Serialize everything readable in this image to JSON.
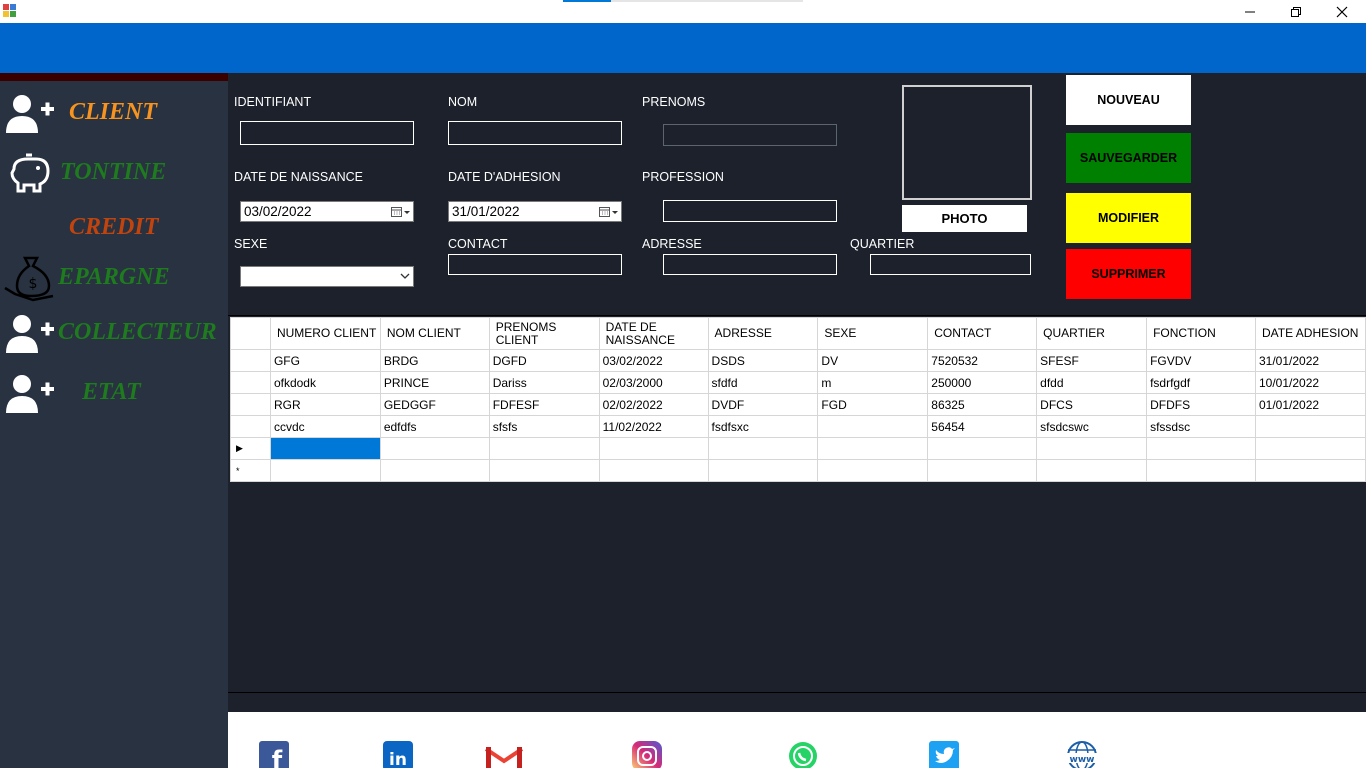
{
  "window": {
    "controls": [
      "minimize",
      "restore",
      "close"
    ]
  },
  "sidebar": {
    "items": [
      {
        "label": "CLIENT",
        "color": "#f7931e"
      },
      {
        "label": "TONTINE",
        "color": "#1e7b1e"
      },
      {
        "label": "CREDIT",
        "color": "#c1440e"
      },
      {
        "label": "EPARGNE",
        "color": "#1e7b1e"
      },
      {
        "label": "COLLECTEUR",
        "color": "#1e7b1e"
      },
      {
        "label": "ETAT",
        "color": "#1e7b1e"
      }
    ]
  },
  "form": {
    "labels": {
      "identifiant": "IDENTIFIANT",
      "nom": "NOM",
      "prenoms": "PRENOMS",
      "date_naissance": "DATE DE NAISSANCE",
      "date_adhesion": "DATE D'ADHESION",
      "profession": "PROFESSION",
      "sexe": "SEXE",
      "contact": "CONTACT",
      "adresse": "ADRESSE",
      "quartier": "QUARTIER"
    },
    "values": {
      "identifiant": "",
      "nom": "",
      "prenoms": "",
      "date_naissance": "03/02/2022",
      "date_adhesion": "31/01/2022",
      "profession": "",
      "sexe": "",
      "contact": "",
      "adresse": "",
      "quartier": ""
    },
    "photo_label": "PHOTO"
  },
  "actions": {
    "nouveau": {
      "label": "NOUVEAU",
      "color": "#ffffff"
    },
    "sauvegarder": {
      "label": "SAUVEGARDER",
      "color": "#008000"
    },
    "modifier": {
      "label": "MODIFIER",
      "color": "#ffff00"
    },
    "supprimer": {
      "label": "SUPPRIMER",
      "color": "#ff0000"
    }
  },
  "grid": {
    "columns": [
      "NUMERO CLIENT",
      "NOM CLIENT",
      "PRENOMS CLIENT",
      "DATE DE NAISSANCE",
      "ADRESSE",
      "SEXE",
      "CONTACT",
      "QUARTIER",
      "FONCTION",
      "DATE ADHESION"
    ],
    "rows": [
      [
        "GFG",
        "BRDG",
        "DGFD",
        "03/02/2022",
        "DSDS",
        "DV",
        "7520532",
        "SFESF",
        "FGVDV",
        "31/01/2022"
      ],
      [
        "ofkdodk",
        "PRINCE",
        "Dariss",
        "02/03/2000",
        "sfdfd",
        "m",
        "250000",
        "dfdd",
        "fsdrfgdf",
        "10/01/2022"
      ],
      [
        "RGR",
        "GEDGGF",
        "FDFESF",
        "02/02/2022",
        "DVDF",
        "FGD",
        "86325",
        "DFCS",
        "DFDFS",
        "01/01/2022"
      ],
      [
        "ccvdc",
        "edfdfs",
        "sfsfs",
        "11/02/2022",
        "fsdfsxc",
        "",
        "56454",
        "sfsdcswc",
        "sfssdsc",
        ""
      ]
    ],
    "current_row_marker": "▶",
    "new_row_marker": "*"
  },
  "footer": {
    "social_icons": [
      "facebook-icon",
      "linkedin-icon",
      "gmail-icon",
      "instagram-icon",
      "whatsapp-icon",
      "twitter-icon",
      "website-icon"
    ],
    "social_text": {
      "facebook": "f",
      "linkedin": "in",
      "website": "www"
    }
  }
}
